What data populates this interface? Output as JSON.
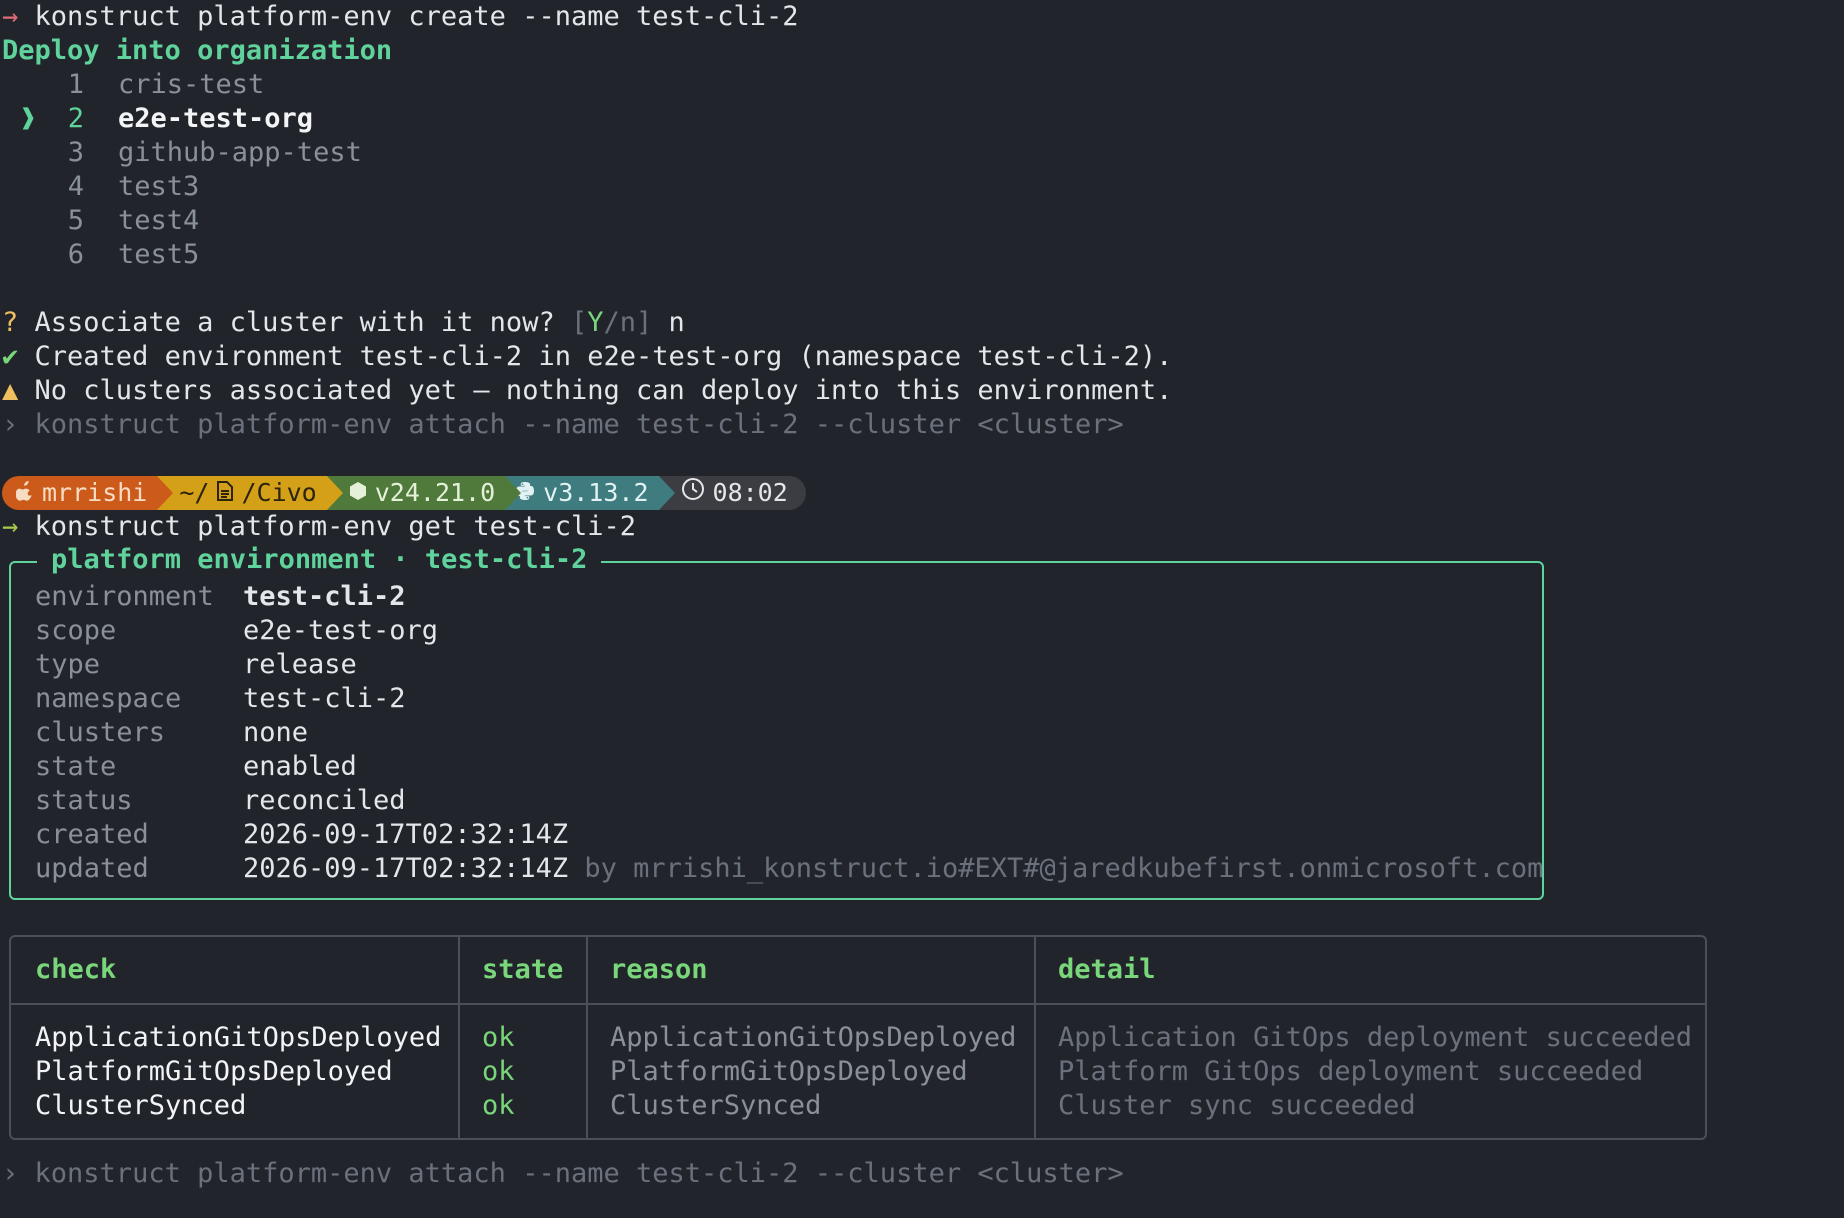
{
  "session": {
    "cmd1_arrow": "→",
    "cmd1": "konstruct platform-env create --name test-cli-2",
    "org_prompt": "Deploy into organization",
    "orgs": [
      {
        "num": "1",
        "name": "cris-test"
      },
      {
        "num": "2",
        "name": "e2e-test-org"
      },
      {
        "num": "3",
        "name": "github-app-test"
      },
      {
        "num": "4",
        "name": "test3"
      },
      {
        "num": "5",
        "name": "test4"
      },
      {
        "num": "6",
        "name": "test5"
      }
    ],
    "selected_org_index": 2,
    "caret": "❱",
    "q_mark": "?",
    "q_text": "Associate a cluster with it now?",
    "q_choices_open": "[",
    "q_choice_y": "Y",
    "q_choice_sep": "/n]",
    "q_answer": "n",
    "ok_mark": "✔",
    "ok_text": "Created environment test-cli-2 in e2e-test-org (namespace test-cli-2).",
    "warn_mark": "▲",
    "warn_text": "No clusters associated yet — nothing can deploy into this environment.",
    "hint_mark": "›",
    "hint_text": "konstruct platform-env attach --name test-cli-2 --cluster <cluster>"
  },
  "prompt_bar": {
    "user": "mrrishi",
    "path_home": "~/",
    "path_dir": "/Civo",
    "node_version": "v24.21.0",
    "python_version": "v3.13.2",
    "time": "08:02",
    "colors": {
      "user": "#cc5a1a",
      "path": "#d4a017",
      "node": "#4f7a3c",
      "python": "#3f7c80",
      "time": "#3b3d42"
    }
  },
  "cmd2": {
    "arrow": "→",
    "text": "konstruct platform-env get test-cli-2"
  },
  "panel": {
    "title": "platform environment · test-cli-2",
    "rows": [
      {
        "key": "environment",
        "value": "test-cli-2"
      },
      {
        "key": "scope",
        "value": "e2e-test-org"
      },
      {
        "key": "type",
        "value": "release"
      },
      {
        "key": "namespace",
        "value": "test-cli-2"
      },
      {
        "key": "clusters",
        "value": "none"
      },
      {
        "key": "state",
        "value": "enabled"
      },
      {
        "key": "status",
        "value": "reconciled"
      },
      {
        "key": "created",
        "value": "2026-09-17T02:32:14Z"
      },
      {
        "key": "updated",
        "value": "2026-09-17T02:32:14Z"
      }
    ],
    "updated_by": "by mrrishi_konstruct.io#EXT#@jaredkubefirst.onmicrosoft.com"
  },
  "checks": {
    "headers": [
      "check",
      "state",
      "reason",
      "detail"
    ],
    "rows": [
      {
        "check": "ApplicationGitOpsDeployed",
        "state": "ok",
        "reason": "ApplicationGitOpsDeployed",
        "detail": "Application GitOps deployment succeeded"
      },
      {
        "check": "PlatformGitOpsDeployed",
        "state": "ok",
        "reason": "PlatformGitOpsDeployed",
        "detail": "Platform GitOps deployment succeeded"
      },
      {
        "check": "ClusterSynced",
        "state": "ok",
        "reason": "ClusterSynced",
        "detail": "Cluster sync succeeded"
      }
    ]
  },
  "footer_hint": {
    "mark": "›",
    "text": "konstruct platform-env attach --name test-cli-2 --cluster <cluster>"
  }
}
